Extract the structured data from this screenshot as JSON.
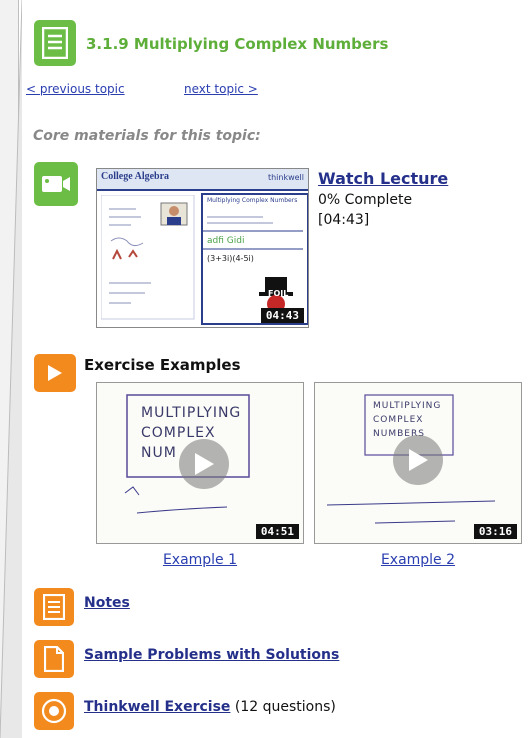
{
  "topic": {
    "title": "3.1.9 Multiplying Complex Numbers"
  },
  "nav": {
    "previous": "< previous topic",
    "next": "next topic >"
  },
  "core_heading": "Core materials for this topic:",
  "lecture": {
    "link": "Watch Lecture",
    "progress": "0% Complete",
    "duration": "[04:43]",
    "thumb_course": "College Algebra",
    "thumb_brand": "thinkwell",
    "thumb_slide_title": "Multiplying Complex Numbers",
    "thumb_badge": "FOIL",
    "thumb_duration": "04:43"
  },
  "exercise_examples": {
    "heading": "Exercise Examples",
    "items": [
      {
        "label": "Example 1",
        "duration": "04:51",
        "line1": "MULTIPLYING",
        "line2": "COMPLEX",
        "line3": "NUM"
      },
      {
        "label": "Example 2",
        "duration": "03:16",
        "line1": "MULTIPLYING",
        "line2": "COMPLEX",
        "line3": "NUMBERS"
      }
    ]
  },
  "resources": {
    "notes": "Notes",
    "sample_problems": "Sample Problems with Solutions",
    "exercise": "Thinkwell Exercise",
    "exercise_count": "(12 questions)"
  },
  "colors": {
    "green": "#6cbd45",
    "orange": "#f28a1e",
    "link": "#2a3eb0"
  }
}
